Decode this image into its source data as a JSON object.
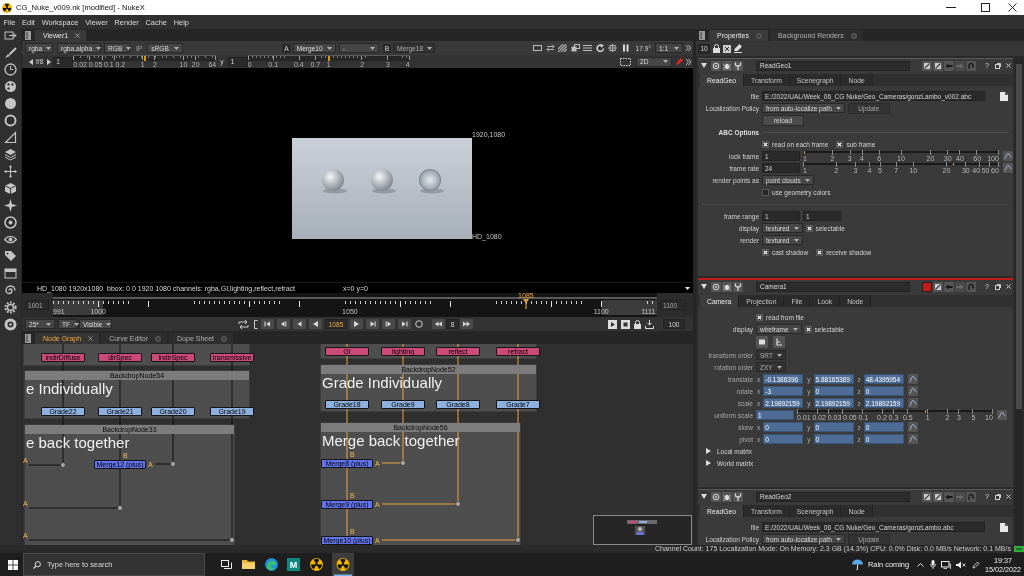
{
  "window": {
    "title": "CG_Nuke_v009.nk [modified] - NukeX"
  },
  "menu": [
    "File",
    "Edit",
    "Workspace",
    "Viewer",
    "Render",
    "Cache",
    "Help"
  ],
  "viewer": {
    "tabs": [
      {
        "label": "Viewer1",
        "selected": true
      }
    ],
    "channels": "rgba",
    "alpha_channel": "rgba.alpha",
    "display_channels": "RGB",
    "input_process": {
      "label": "IP",
      "on": false
    },
    "lut": "sRGB",
    "input_a": {
      "label": "A",
      "node": "Merge10"
    },
    "operation": "-",
    "input_b": {
      "label": "B",
      "node": "Merge18",
      "disabled": true
    },
    "angle_readout": "17.9°",
    "ratio": "1:1",
    "gain": {
      "label": "f/8",
      "value": "1",
      "level": 0.5,
      "ticks": [
        "0.02",
        "0.05",
        "0.1",
        "0.2",
        "1",
        "2",
        "10",
        "20",
        "64"
      ]
    },
    "gamma": {
      "label": "y",
      "value": "1",
      "level": 0.5,
      "ticks": [
        "0",
        "0.1",
        "0.4",
        "0.7",
        "1",
        "2",
        "3",
        "4"
      ]
    },
    "view_mode": "2D",
    "image": {
      "size_label": "1920,1080",
      "format_label": "HD_1080"
    },
    "info": "HD_1080 1920x1080  bbox: 0 0 1920 1080 channels: rgba,GI,lighting,reflect,refract",
    "cursor": "x=0 y=0"
  },
  "timeline": {
    "first": "1001",
    "last": "1100",
    "ticks": [
      "991",
      "1000",
      "1050",
      "1100",
      "1111"
    ],
    "playhead_label": "1085",
    "level": 0.783,
    "fps": "25*",
    "time_format": "TF",
    "range": "Visible",
    "frame": "1085",
    "increment": "8",
    "playback_field": "100"
  },
  "node_graph": {
    "tabs": [
      {
        "label": "Node Graph",
        "selected": true
      },
      {
        "label": "Curve Editor",
        "selected": false
      },
      {
        "label": "Dope Sheet",
        "selected": false
      }
    ],
    "branches": [
      {
        "highlighted": false,
        "read_nodes": [
          "indirDiffuse",
          "dirSpec",
          "indirSpec",
          "transmissive"
        ],
        "grade_backdrop": {
          "name": "BackdropNode54",
          "label": "e Individually"
        },
        "grade_nodes": [
          "Grade22",
          "Grade21",
          "Grade20",
          "Grade19"
        ],
        "merge_backdrop": {
          "name": "BackdropNode33",
          "label": "e back together"
        },
        "merge_nodes": [
          {
            "label": "Merge12 (plus)",
            "input_a": "A",
            "input_b": "B"
          }
        ],
        "edge_inputs": [
          "A",
          "A",
          "A"
        ]
      },
      {
        "highlighted": true,
        "read_nodes": [
          "GI",
          "lighting",
          "reflect",
          "refract"
        ],
        "grade_backdrop": {
          "name": "BackdropNode52",
          "label": "Grade Individually"
        },
        "grade_nodes": [
          "Grade18",
          "Grade9",
          "Grade8",
          "Grade7"
        ],
        "merge_backdrop": {
          "name": "BackdropNode56",
          "label": "Merge back together"
        },
        "merge_nodes": [
          {
            "label": "Merge8 (plus)",
            "input_a": "A",
            "input_b": "B"
          },
          {
            "label": "Merge9 (plus)",
            "input_a": "A",
            "input_b": "B"
          },
          {
            "label": "Merge10 (plus)",
            "input_a": "A",
            "input_b": "B"
          }
        ]
      }
    ]
  },
  "properties": {
    "tabs": [
      {
        "label": "Properties",
        "selected": true
      },
      {
        "label": "Background Renders",
        "selected": false
      }
    ],
    "max_panels": "10",
    "panels": [
      {
        "kind": "readgeo",
        "name": "ReadGeo1",
        "help": "?",
        "tabs": [
          {
            "label": "ReadGeo",
            "selected": true
          },
          {
            "label": "Transform",
            "selected": false
          },
          {
            "label": "Scenegraph",
            "selected": false
          },
          {
            "label": "Node",
            "selected": false
          }
        ],
        "rows": [
          {
            "kind": "file",
            "label": "file",
            "value": "E:/2022/UAL/Week_06_CG Nuke/Geo_Cameras/gonzLambo_v002.abc"
          },
          {
            "kind": "dropdown",
            "label": "Localization Policy",
            "value": "from auto-localize path",
            "button": {
              "label": "Update",
              "disabled": true
            }
          },
          {
            "kind": "button",
            "label": "reload"
          },
          {
            "kind": "heading",
            "label": "ABC Options"
          },
          {
            "kind": "checks",
            "items": [
              {
                "label": "read on each frame",
                "checked": true
              },
              {
                "label": "sub frame",
                "checked": true
              }
            ]
          },
          {
            "kind": "slider",
            "label": "lock frame",
            "value": "1",
            "level": 0,
            "ticks": [
              "1",
              "2",
              "3",
              "4",
              "6",
              "10",
              "20",
              "30",
              "40",
              "60",
              "100"
            ]
          },
          {
            "kind": "slider",
            "label": "frame rate",
            "value": "24",
            "level": 0.77,
            "ticks": [
              "1",
              "2",
              "3",
              "4",
              "5",
              "7",
              "10",
              "20",
              "30",
              "40",
              "50",
              "60"
            ]
          },
          {
            "kind": "dropdown",
            "label": "render points as",
            "value": "point clouds"
          },
          {
            "kind": "checks",
            "items": [
              {
                "label": "use geometry colors",
                "checked": false
              }
            ]
          },
          {
            "kind": "divider"
          },
          {
            "kind": "pair",
            "label": "frame range",
            "values": [
              "1",
              "1"
            ]
          },
          {
            "kind": "dropdown",
            "label": "display",
            "value": "textured",
            "check": {
              "label": "selectable",
              "checked": true
            }
          },
          {
            "kind": "dropdown",
            "label": "render",
            "value": "textured"
          },
          {
            "kind": "checks",
            "items": [
              {
                "label": "cast shadow",
                "checked": true
              },
              {
                "label": "receive shadow",
                "checked": true
              }
            ]
          }
        ]
      },
      {
        "kind": "camera",
        "name": "Camera1",
        "help": "?",
        "color": "#c41a1a",
        "tabs": [
          {
            "label": "Camera",
            "selected": true
          },
          {
            "label": "Projection",
            "selected": false
          },
          {
            "label": "File",
            "selected": false
          },
          {
            "label": "Look",
            "selected": false
          },
          {
            "label": "Node",
            "selected": false
          }
        ],
        "rows": [
          {
            "kind": "checks",
            "items": [
              {
                "label": "read from file",
                "checked": true
              }
            ]
          },
          {
            "kind": "dropdown",
            "label": "display",
            "value": "wireframe",
            "check": {
              "label": "selectable",
              "checked": true
            }
          },
          {
            "kind": "icon_buttons"
          },
          {
            "kind": "dropdown",
            "label": "transform order",
            "value": "SRT",
            "disabled": true
          },
          {
            "kind": "dropdown",
            "label": "rotation order",
            "value": "ZXY",
            "disabled": true
          },
          {
            "kind": "vector",
            "label": "translate",
            "disabled": true,
            "animated": true,
            "components": [
              {
                "axis": "x",
                "value": "-0.1386396"
              },
              {
                "axis": "y",
                "value": "5.88165389"
              },
              {
                "axis": "z",
                "value": "48.4395954"
              }
            ]
          },
          {
            "kind": "vector",
            "label": "rotate",
            "disabled": true,
            "animated": true,
            "components": [
              {
                "axis": "x",
                "value": "-3"
              },
              {
                "axis": "y",
                "value": "0"
              },
              {
                "axis": "z",
                "value": "0"
              }
            ]
          },
          {
            "kind": "vector",
            "label": "scale",
            "disabled": true,
            "animated": true,
            "components": [
              {
                "axis": "x",
                "value": "2.19892159"
              },
              {
                "axis": "y",
                "value": "2.19892159"
              },
              {
                "axis": "z",
                "value": "2.19892159"
              }
            ]
          },
          {
            "kind": "slider",
            "label": "uniform scale",
            "value": "1",
            "level": 0.66,
            "disabled": true,
            "animated": true,
            "ticks": [
              "0.01",
              "0.02",
              "0.03",
              "0.05",
              "0.1",
              "0.2",
              "0.3",
              "0.5",
              "1",
              "2",
              "3",
              "5",
              "10"
            ]
          },
          {
            "kind": "vector",
            "label": "skew",
            "disabled": true,
            "animated": true,
            "components": [
              {
                "axis": "x",
                "value": "0"
              },
              {
                "axis": "y",
                "value": "0"
              },
              {
                "axis": "z",
                "value": "0"
              }
            ]
          },
          {
            "kind": "vector",
            "label": "pivot",
            "disabled": true,
            "animated": true,
            "components": [
              {
                "axis": "x",
                "value": "0"
              },
              {
                "axis": "y",
                "value": "0"
              },
              {
                "axis": "z",
                "value": "0"
              }
            ]
          },
          {
            "kind": "expander",
            "label": "Local matrix",
            "expanded": false
          },
          {
            "kind": "expander",
            "label": "World matrix",
            "expanded": false
          }
        ]
      },
      {
        "kind": "readgeo",
        "name": "ReadGeo2",
        "help": "?",
        "tabs": [
          {
            "label": "ReadGeo",
            "selected": true
          },
          {
            "label": "Transform",
            "selected": false
          },
          {
            "label": "Scenegraph",
            "selected": false
          },
          {
            "label": "Node",
            "selected": false
          }
        ],
        "rows": [
          {
            "kind": "file",
            "label": "file",
            "value": "E:/2022/UAL/Week_06_CG Nuke/Geo_Cameras/gonzLambo.abc"
          },
          {
            "kind": "dropdown",
            "label": "Localization Policy",
            "value": "from auto-localize path",
            "button": {
              "label": "Update",
              "disabled": true
            }
          }
        ]
      }
    ]
  },
  "status_bar": "Channel Count: 175 Localization Mode: On Memory: 2.3 GB (14.3%) CPU: 0.0% Disk: 0.0 MB/s Network: 0.1 MB/s",
  "taskbar": {
    "search_placeholder": "Type here to search",
    "apps": [
      {
        "kind": "folder",
        "selected": false
      },
      {
        "kind": "browser",
        "selected": false
      },
      {
        "kind": "tile",
        "label": "M",
        "selected": false
      },
      {
        "kind": "nuke",
        "selected": false
      },
      {
        "kind": "nuke",
        "selected": true
      }
    ],
    "weather": "Rain coming",
    "time": "19:37",
    "date": "15/02/2022"
  }
}
